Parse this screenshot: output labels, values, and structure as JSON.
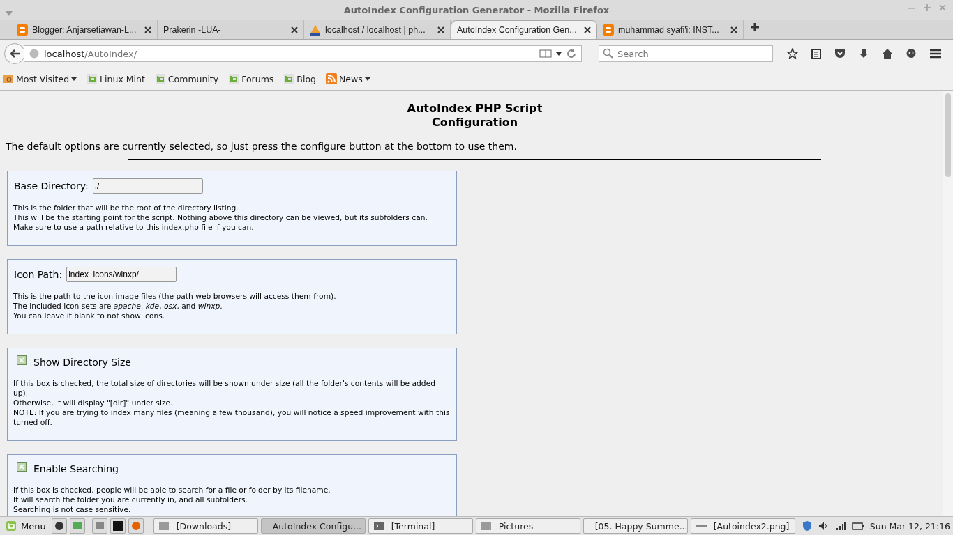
{
  "window": {
    "title": "AutoIndex Configuration Generator - Mozilla Firefox"
  },
  "tabs": [
    {
      "label": "Blogger: Anjarsetiawan-L...",
      "kind": "blogger",
      "selected": false
    },
    {
      "label": "Prakerin -LUA-",
      "kind": "plain",
      "selected": false
    },
    {
      "label": "localhost / localhost | ph...",
      "kind": "pma",
      "selected": false
    },
    {
      "label": "AutoIndex Configuration Gen...",
      "kind": "plain",
      "selected": true
    },
    {
      "label": "muhammad syafi'i: INST...",
      "kind": "blogger",
      "selected": false
    }
  ],
  "address": {
    "host": "localhost",
    "path": "/AutoIndex/"
  },
  "search": {
    "placeholder": "Search"
  },
  "bookmarks": [
    {
      "label": "Most Visited",
      "kind": "folder",
      "dropdown": true
    },
    {
      "label": "Linux Mint",
      "kind": "mint",
      "dropdown": false
    },
    {
      "label": "Community",
      "kind": "mint",
      "dropdown": false
    },
    {
      "label": "Forums",
      "kind": "mint",
      "dropdown": false
    },
    {
      "label": "Blog",
      "kind": "mint",
      "dropdown": false
    },
    {
      "label": "News",
      "kind": "rss",
      "dropdown": true
    }
  ],
  "page": {
    "heading": [
      "AutoIndex PHP Script",
      "Configuration"
    ],
    "intro": "The default options are currently selected, so just press the configure button at the bottom to use them.",
    "sections": [
      {
        "kind": "field",
        "label": "Base Directory:",
        "value": "./",
        "lines": [
          "This is the folder that will be the root of the directory listing.",
          "This will be the starting point for the script. Nothing above this directory can be viewed, but its subfolders can.",
          "Make sure to use a path relative to this index.php file if you can."
        ]
      },
      {
        "kind": "field",
        "label": "Icon Path:",
        "value": "index_icons/winxp/",
        "lines": [
          "This is the path to the icon image files (the path web browsers will access them from).",
          "The included icon sets are *apache*, *kde*, *osx*, and *winxp*.",
          "You can leave it blank to not show icons."
        ]
      },
      {
        "kind": "checkbox",
        "label": "Show Directory Size",
        "checked": true,
        "lines": [
          "If this box is checked, the total size of directories will be shown under size (all the folder's contents will be added up).",
          "Otherwise, it will display \"[dir]\" under size.",
          "NOTE: If you are trying to index many files (meaning a few thousand), you will notice a speed improvement with this turned off."
        ]
      },
      {
        "kind": "checkbox",
        "label": "Enable Searching",
        "checked": true,
        "lines": [
          "If this box is checked, people will be able to search for a file or folder by its filename.",
          "It will search the folder you are currently in, and all subfolders.",
          "Searching is not case sensitive."
        ]
      }
    ]
  },
  "taskbar": {
    "menu": "Menu",
    "windows": [
      {
        "label": "[Downloads]",
        "kind": "folder",
        "selected": false
      },
      {
        "label": "AutoIndex Configu...",
        "kind": "firefox",
        "selected": true
      },
      {
        "label": "[Terminal]",
        "kind": "terminal",
        "selected": false
      },
      {
        "label": "Pictures",
        "kind": "folder",
        "selected": false
      },
      {
        "label": "[05. Happy Summe...",
        "kind": "video",
        "selected": false
      },
      {
        "label": "[Autoindex2.png]",
        "kind": "dash",
        "selected": false
      }
    ],
    "clock": "Sun Mar 12, 21:16"
  }
}
